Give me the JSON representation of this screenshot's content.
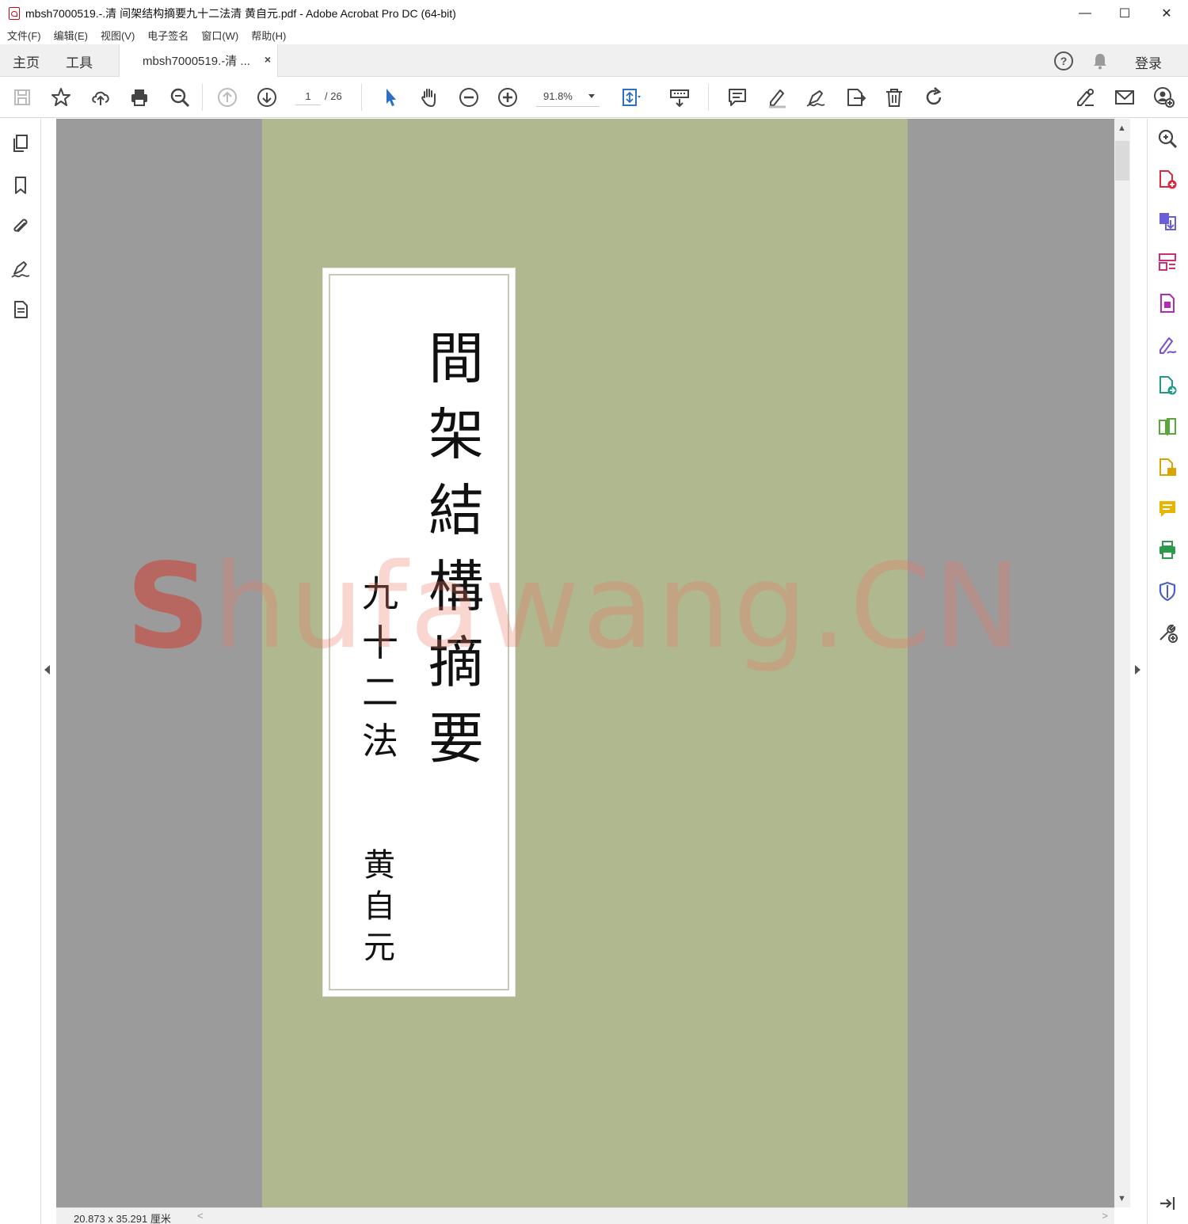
{
  "window": {
    "title": "mbsh7000519.-.清 间架结构摘要九十二法清 黄自元.pdf - Adobe Acrobat Pro DC (64-bit)",
    "controls": [
      "—",
      "☐",
      "✕"
    ]
  },
  "menu": [
    "文件(F)",
    "编辑(E)",
    "视图(V)",
    "电子签名",
    "窗口(W)",
    "帮助(H)"
  ],
  "tabs": {
    "home": "主页",
    "tools": "工具",
    "document": "mbsh7000519.-清 ...",
    "close": "×",
    "signin": "登录"
  },
  "toolbar": {
    "current_page": "1",
    "total_pages": "/ 26",
    "zoom": "91.8%",
    "icons": [
      "save-icon",
      "bookmark-star-icon",
      "upload-cloud-icon",
      "print-icon",
      "zoom-search-icon",
      "previous-page-icon",
      "next-page-icon",
      "select-arrow-icon",
      "hand-tool-icon",
      "zoom-out-icon",
      "zoom-in-icon",
      "fit-page-icon",
      "keyboard-scroll-icon",
      "comment-icon",
      "highlight-icon",
      "sign-icon",
      "export-icon",
      "delete-icon",
      "rotate-icon",
      "fill-sign-icon",
      "email-icon",
      "share-user-icon"
    ]
  },
  "left_rail": [
    "page-thumbnails-icon",
    "bookmarks-icon",
    "attachments-icon",
    "signatures-icon",
    "document-info-icon"
  ],
  "right_rail": [
    "search-zoom-icon",
    "create-pdf-icon",
    "export-pdf-icon",
    "organize-pages-icon",
    "edit-pdf-icon",
    "fill-sign-icon",
    "send-for-review-icon",
    "compare-icon",
    "scan-ocr-icon",
    "comment-icon",
    "print-production-icon",
    "protect-icon",
    "more-tools-icon",
    "collapse-panel-icon"
  ],
  "document": {
    "title_chars": [
      "間",
      "架",
      "結",
      "構",
      "摘",
      "要"
    ],
    "subtitle_chars": [
      "九",
      "十",
      "二",
      "法"
    ],
    "author_chars": [
      "黄",
      "自",
      "元"
    ],
    "watermark_first": "S",
    "watermark_rest": "hufawang.CN"
  },
  "colors": {
    "page_background": "#b0b890",
    "viewport_background": "#9b9b9b",
    "acrobat_red": "#d0021b",
    "tool_blue": "#2b6fc7"
  },
  "status": {
    "page_size": "20.873 x 35.291 厘米"
  }
}
